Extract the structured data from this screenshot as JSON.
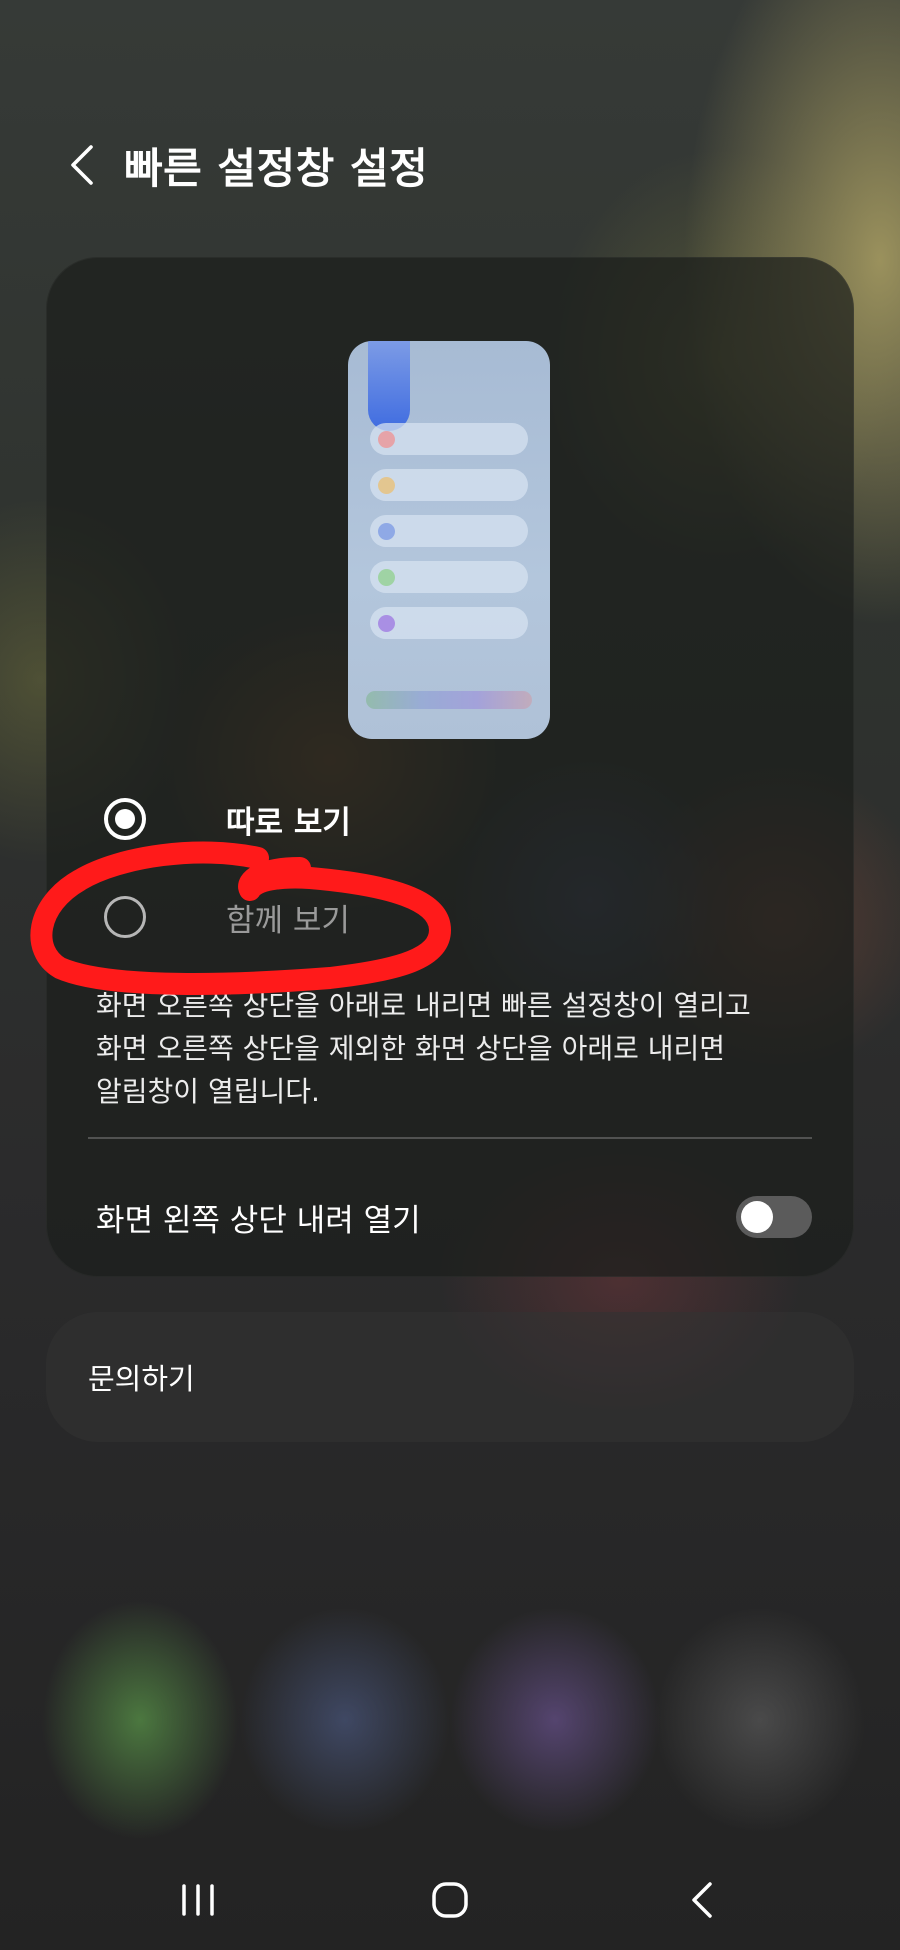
{
  "header": {
    "title": "빠른 설정창 설정",
    "back_icon": "chevron-left-icon"
  },
  "panel_options": [
    {
      "label": "따로 보기",
      "selected": true
    },
    {
      "label": "함께 보기",
      "selected": false
    }
  ],
  "description": {
    "line1": "화면 오른쪽 상단을 아래로 내리면 빠른 설정창이 열리고",
    "line2": "화면 오른쪽 상단을 제외한 화면 상단을 아래로 내리면",
    "line3": "알림창이 열립니다."
  },
  "toggle_setting": {
    "label": "화면 왼쪽 상단 내려 열기",
    "enabled": false
  },
  "contact": {
    "label": "문의하기"
  },
  "annotation": {
    "color": "#ff1a1a",
    "target": "함께 보기"
  },
  "nav_icons": {
    "recents": "recents-icon",
    "home": "home-icon",
    "back": "back-icon"
  }
}
